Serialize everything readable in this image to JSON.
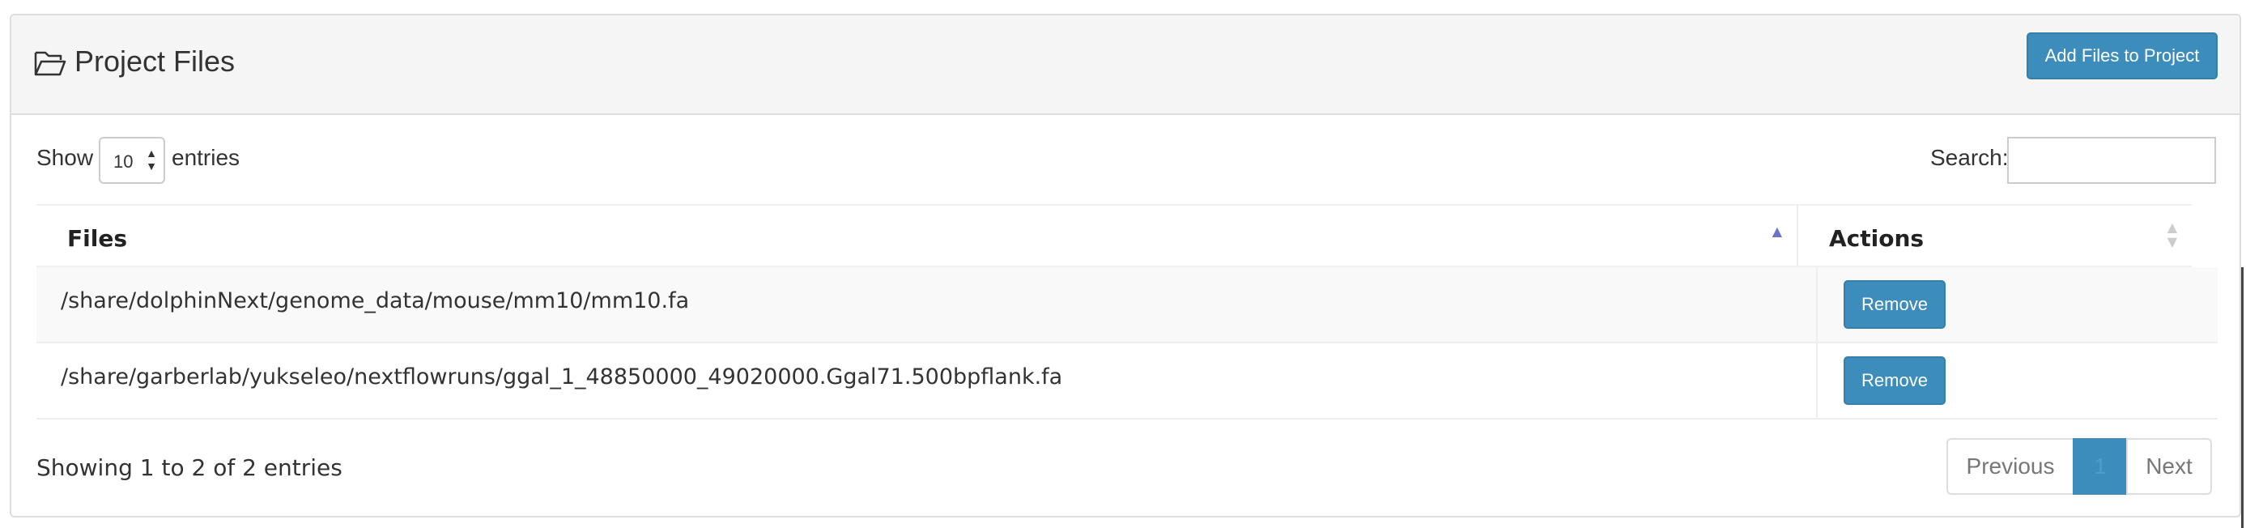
{
  "panel": {
    "title": "Project Files",
    "title_icon": "folder-open-icon",
    "add_button": "Add Files to Project"
  },
  "controls": {
    "show_label": "Show",
    "length_value": "10",
    "entries_label": "entries",
    "search_label": "Search:",
    "search_value": ""
  },
  "table": {
    "headers": [
      "Files",
      "Actions"
    ],
    "sorted_column": "Files",
    "sort_direction": "ascending",
    "rows": [
      {
        "file": "/share/dolphinNext/genome_data/mouse/mm10/mm10.fa",
        "action": "Remove"
      },
      {
        "file": "/share/garberlab/yukseleo/nextflowruns/ggal_1_48850000_49020000.Ggal71.500bpflank.fa",
        "action": "Remove"
      }
    ]
  },
  "footer": {
    "info": "Showing 1 to 2 of 2 entries",
    "previous": "Previous",
    "current_page": "1",
    "next": "Next"
  },
  "colors": {
    "primary": "#3c8dbc",
    "header_bg": "#f5f5f5",
    "sort_indicator": "#6a73c9"
  }
}
